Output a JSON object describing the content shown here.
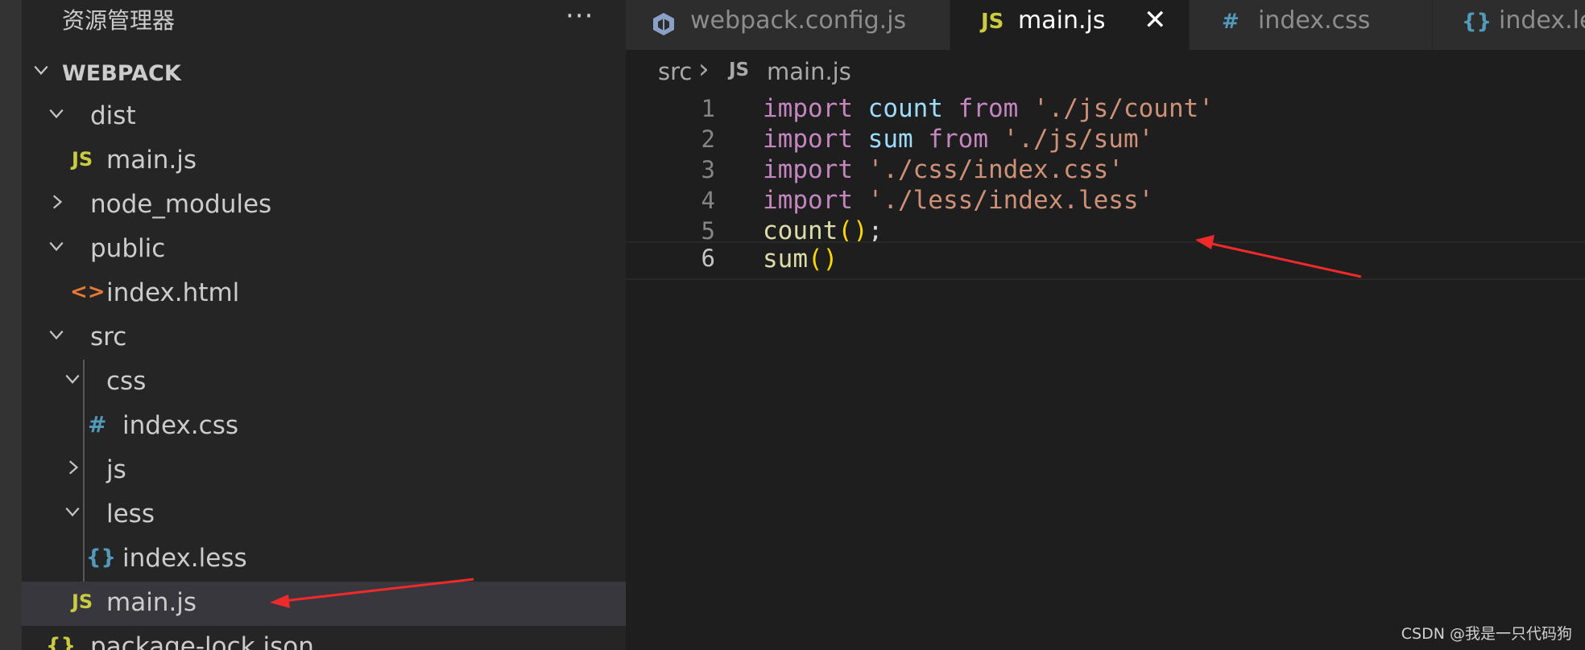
{
  "explorer": {
    "title": "资源管理器",
    "more": "···",
    "root": "WEBPACK",
    "items": [
      {
        "label": "dist",
        "icon": "",
        "expanded": true
      },
      {
        "label": "main.js",
        "icon": "JS"
      },
      {
        "label": "node_modules",
        "icon": "",
        "expanded": false
      },
      {
        "label": "public",
        "icon": "",
        "expanded": true
      },
      {
        "label": "index.html",
        "icon": "<>"
      },
      {
        "label": "src",
        "icon": "",
        "expanded": true
      },
      {
        "label": "css",
        "icon": "",
        "expanded": true
      },
      {
        "label": "index.css",
        "icon": "#"
      },
      {
        "label": "js",
        "icon": "",
        "expanded": false
      },
      {
        "label": "less",
        "icon": "",
        "expanded": true
      },
      {
        "label": "index.less",
        "icon": "{}"
      },
      {
        "label": "main.js",
        "icon": "JS",
        "selected": true
      },
      {
        "label": "package-lock.json",
        "icon": "{}"
      }
    ]
  },
  "tabs": [
    {
      "label": "webpack.config.js",
      "icon": "package-icon"
    },
    {
      "label": "main.js",
      "icon": "JS",
      "active": true,
      "close": "✕"
    },
    {
      "label": "index.css",
      "icon": "#"
    },
    {
      "label": "index.le",
      "icon": "{}"
    }
  ],
  "breadcrumb": {
    "folder": "src",
    "separator": "›",
    "icon": "JS",
    "file": "main.js"
  },
  "code": {
    "lines": [
      {
        "num": "1",
        "tokens": [
          "import",
          "count",
          "from",
          "'./js/count'"
        ]
      },
      {
        "num": "2",
        "tokens": [
          "import",
          "sum",
          "from",
          "'./js/sum'"
        ]
      },
      {
        "num": "3",
        "tokens": [
          "import",
          "'./css/index.css'"
        ]
      },
      {
        "num": "4",
        "tokens": [
          "import",
          "'./less/index.less'"
        ]
      },
      {
        "num": "5",
        "tokens": [
          "count",
          "()",
          ";"
        ]
      },
      {
        "num": "6",
        "tokens": [
          "sum",
          "()"
        ]
      }
    ]
  },
  "watermark": "CSDN @我是一只代码狗",
  "colors": {
    "annotation_arrow": "#f02a2a",
    "js_icon": "#cbcb41",
    "keyword": "#c586c0",
    "string": "#ce9178"
  }
}
